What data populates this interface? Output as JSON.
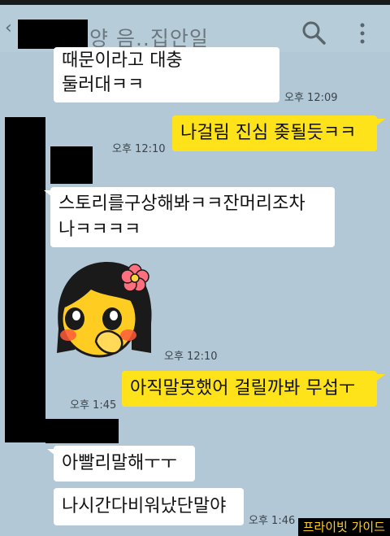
{
  "header": {
    "title": "양 음..집안일",
    "back_icon": "chevron-left-icon",
    "search_icon": "search-icon",
    "more_icon": "more-vertical-icon"
  },
  "messages": [
    {
      "side": "in",
      "lines": [
        "때문이라고 대충",
        "둘러대ㅋㅋ"
      ],
      "time": "오후 12:09"
    },
    {
      "side": "out",
      "lines": [
        "나걸림 진심 좆될듯ㅋㅋ"
      ],
      "time": "오후 12:10"
    },
    {
      "side": "in",
      "lines": [
        "스토리를구상해봐ㅋㅋ잔머리조차",
        "나ㅋㅋㅋㅋ"
      ],
      "time": ""
    },
    {
      "side": "in",
      "type": "emoticon",
      "emoticon": "blushing-girl-emoticon",
      "time": "오후 12:10"
    },
    {
      "side": "out",
      "lines": [
        "아직말못했어 걸릴까봐 무섭ㅜ"
      ],
      "time": "오후 1:45"
    },
    {
      "side": "in",
      "lines": [
        "아빨리말해ㅜㅜ"
      ],
      "time": ""
    },
    {
      "side": "in",
      "lines": [
        "나시간다비워났단말야"
      ],
      "time": "오후 1:46"
    }
  ],
  "watermark": "프라이빗 가이드",
  "colors": {
    "background": "#b3c8d6",
    "incoming": "#ffffff",
    "outgoing": "#ffe31a"
  }
}
